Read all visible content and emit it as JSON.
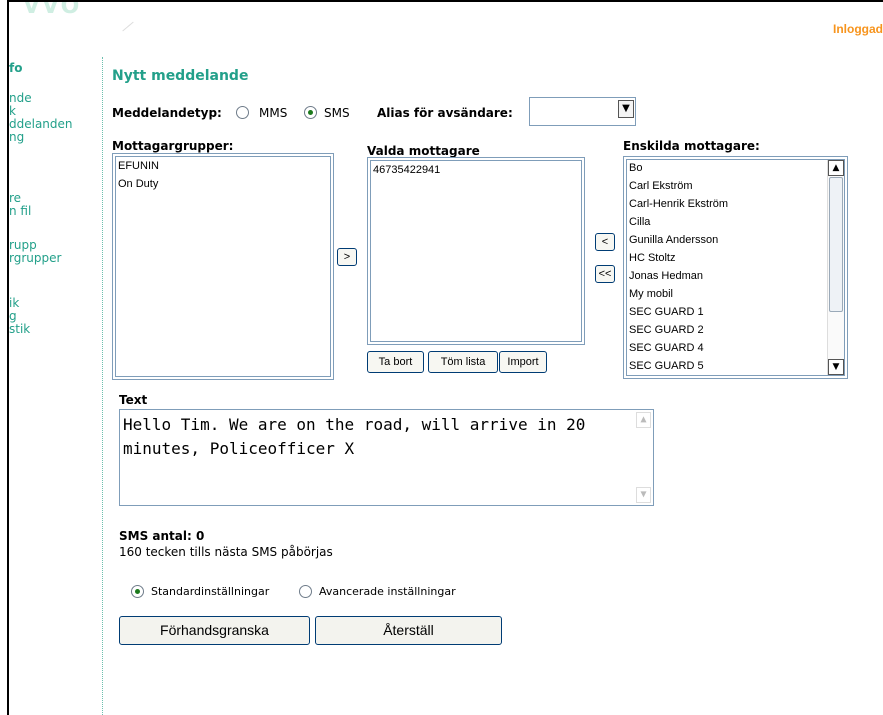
{
  "header": {
    "logged_in_label": "Inloggad"
  },
  "sidebar": {
    "items": [
      {
        "label": "fo",
        "head": true
      },
      {
        "label": "nde"
      },
      {
        "label": "k"
      },
      {
        "label": "ddelanden"
      },
      {
        "label": "ng"
      },
      {
        "label": "re"
      },
      {
        "label": "n fil"
      },
      {
        "label": "rupp"
      },
      {
        "label": "rgrupper"
      },
      {
        "label": "ik"
      },
      {
        "label": "g"
      },
      {
        "label": "stik"
      }
    ]
  },
  "form": {
    "title": "Nytt meddelande",
    "message_type_label": "Meddelandetyp:",
    "mms_label": "MMS",
    "sms_label": "SMS",
    "alias_label": "Alias för avsändare:",
    "alias_value": "",
    "groups_label": "Mottagargrupper:",
    "selected_label": "Valda mottagare",
    "individual_label": "Enskilda mottagare:",
    "groups": [
      "EFUNIN",
      "On Duty"
    ],
    "selected": [
      "46735422941"
    ],
    "individuals": [
      "Bo",
      "Carl Ekström",
      "Carl-Henrik Ekström",
      "Cilla",
      "Gunilla Andersson",
      "HC Stoltz",
      "Jonas Hedman",
      "My mobil",
      "SEC GUARD 1",
      "SEC GUARD 2",
      "SEC GUARD 4",
      "SEC GUARD 5"
    ],
    "add_group_btn": ">",
    "remove_one_btn": "<",
    "remove_all_btn": "<<",
    "remove_btn": "Ta bort",
    "clear_btn": "Töm lista",
    "import_btn": "Import",
    "text_label": "Text",
    "text_value": "Hello Tim. We are on the road, will arrive in 20 minutes, Policeofficer X",
    "sms_count_label": "SMS antal: 0",
    "chars_left": "160 tecken tills nästa SMS påbörjas",
    "standard_label": "Standardinställningar",
    "advanced_label": "Avancerade inställningar",
    "preview_btn": "Förhandsgranska",
    "reset_btn": "Återställ"
  }
}
